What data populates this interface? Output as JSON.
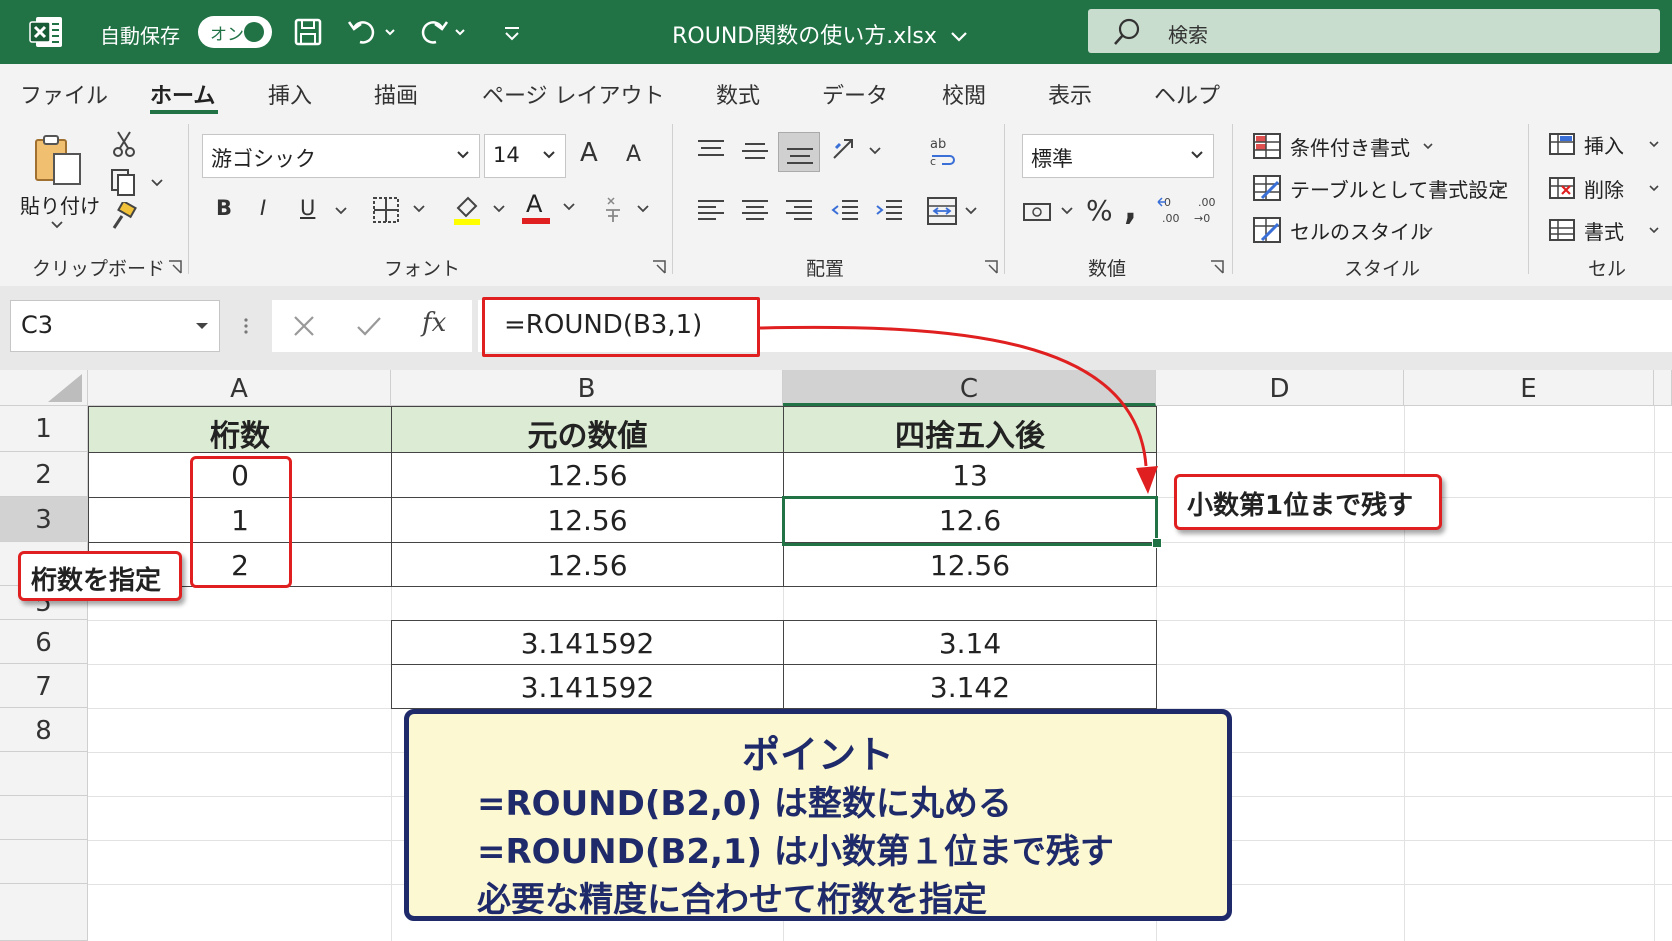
{
  "titlebar": {
    "autosave_label": "自動保存",
    "autosave_state": "オン",
    "filename": "ROUND関数の使い方.xlsx",
    "search_placeholder": "検索"
  },
  "tabs": [
    "ファイル",
    "ホーム",
    "挿入",
    "描画",
    "ページ レイアウト",
    "数式",
    "データ",
    "校閲",
    "表示",
    "ヘルプ"
  ],
  "active_tab": "ホーム",
  "ribbon": {
    "clipboard": {
      "paste_label": "貼り付け",
      "group_label": "クリップボード"
    },
    "font": {
      "font_name": "游ゴシック",
      "font_size": "14",
      "bold": "B",
      "italic": "I",
      "underline": "U",
      "grow": "A",
      "shrink": "A",
      "color_letter": "A",
      "group_label": "フォント"
    },
    "alignment": {
      "group_label": "配置"
    },
    "number": {
      "format": "標準",
      "percent": "%",
      "comma": ",",
      "group_label": "数値"
    },
    "styles": {
      "conditional": "条件付き書式",
      "table": "テーブルとして書式設定",
      "cell_styles": "セルのスタイル",
      "group_label": "スタイル"
    },
    "cells": {
      "insert": "挿入",
      "delete": "削除",
      "format": "書式",
      "group_label": "セル"
    }
  },
  "formula_bar": {
    "name_box": "C3",
    "fx": "fx",
    "formula": "=ROUND(B3,1)"
  },
  "sheet": {
    "columns": [
      "A",
      "B",
      "C",
      "D",
      "E"
    ],
    "rows": [
      "1",
      "2",
      "3",
      "4",
      "5",
      "6",
      "7",
      "8"
    ],
    "header_row": {
      "A": "桁数",
      "B": "元の数値",
      "C": "四捨五入後"
    },
    "data_rows": [
      {
        "A": "0",
        "B": "12.56",
        "C": "13"
      },
      {
        "A": "1",
        "B": "12.56",
        "C": "12.6"
      },
      {
        "A": "2",
        "B": "12.56",
        "C": "12.56"
      }
    ],
    "extra_rows": [
      {
        "B": "3.141592",
        "C": "3.14"
      },
      {
        "B": "3.141592",
        "C": "3.142"
      }
    ]
  },
  "annotations": {
    "digits_callout": "桁数を指定",
    "result_callout": "小数第1位まで残す",
    "point_title": "ポイント",
    "point_lines": [
      "=ROUND(B2,0) は整数に丸める",
      "=ROUND(B2,1) は小数第１位まで残す",
      "必要な精度に合わせて桁数を指定"
    ]
  },
  "colors": {
    "excel_green": "#217346",
    "highlight_red": "#e02020",
    "header_fill": "#dcebd3",
    "point_fill": "#fcf8d2",
    "point_border": "#1f2a6b"
  }
}
